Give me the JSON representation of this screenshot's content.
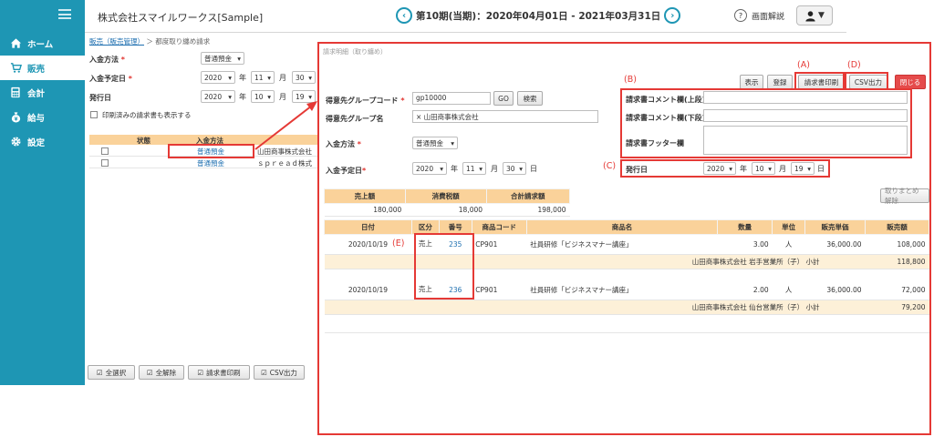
{
  "sidebar": {
    "items": [
      {
        "label": "ホーム",
        "icon": "home-icon"
      },
      {
        "label": "販売",
        "icon": "cart-icon"
      },
      {
        "label": "会計",
        "icon": "calculator-icon"
      },
      {
        "label": "給与",
        "icon": "moneybag-icon"
      },
      {
        "label": "設定",
        "icon": "gear-icon"
      }
    ]
  },
  "header": {
    "company": "株式会社スマイルワークス[Sample]",
    "period": "第10期(当期)：2020年04月01日 - 2021年03月31日",
    "help": "画面解説",
    "help_symbol": "?",
    "prev_symbol": "‹",
    "next_symbol": "›",
    "user_symbol": "▼"
  },
  "base": {
    "breadcrumb_link": "販売（販売管理）",
    "breadcrumb_rest": " ＞ 都度取り纏め請求",
    "label_payment": "入金方法",
    "label_due": "入金予定日",
    "label_issue": "発行日",
    "required_mark": "*",
    "payment_value": "普通預金",
    "due": {
      "year": "2020",
      "month": "11",
      "day": "30"
    },
    "issue": {
      "year": "2020",
      "month": "10",
      "day": "19"
    },
    "u_year": "年",
    "u_month": "月",
    "checkbox_label": "印刷済みの請求書も表示する",
    "table_headers": [
      "状態",
      "入金方法"
    ],
    "rows": [
      {
        "method": "普通預金",
        "customer": "山田商事株式会社"
      },
      {
        "method": "普通預金",
        "customer": "ｓｐｒｅａｄ株式"
      }
    ],
    "buttons": [
      "全選択",
      "全解除",
      "請求書印刷",
      "CSV出力"
    ]
  },
  "modal": {
    "title": "請求明細（取り纏め）",
    "toolbar": [
      "表示",
      "登録",
      "請求書印刷",
      "CSV出力",
      "閉じる"
    ],
    "label_group_code": "得意先グループコード",
    "group_code": "gp10000",
    "btn_go": "GO",
    "btn_search": "検索",
    "label_group_name": "得意先グループ名",
    "group_name": "× 山田商事株式会社",
    "label_payment": "入金方法",
    "payment_value": "普通預金",
    "label_due": "入金予定日",
    "due": {
      "year": "2020",
      "month": "11",
      "day": "30"
    },
    "label_comment_top": "請求書コメント欄(上段)",
    "label_comment_bottom": "請求書コメント欄(下段)",
    "label_footer": "請求書フッター欄",
    "label_issue": "発行日",
    "issue": {
      "year": "2020",
      "month": "10",
      "day": "19"
    },
    "btn_unmerge": "取りまとめ解除",
    "summary": {
      "headers": [
        "売上額",
        "消費税額",
        "合計請求額"
      ],
      "values": [
        "180,000",
        "18,000",
        "198,000"
      ]
    },
    "detail_headers": [
      "日付",
      "区分",
      "番号",
      "商品コード",
      "商品名",
      "数量",
      "単位",
      "販売単価",
      "販売額"
    ],
    "details": [
      {
        "date": "2020/10/19",
        "kubun": "売上",
        "number": "235",
        "code": "CP901",
        "product": "社員研修「ビジネスマナー講座」",
        "qty": "3.00",
        "unit": "人",
        "price": "36,000.00",
        "amount": "108,000",
        "subtotal_label": "山田商事株式会社 岩手営業所（子） 小計",
        "subtotal": "118,800"
      },
      {
        "date": "2020/10/19",
        "kubun": "売上",
        "number": "236",
        "code": "CP901",
        "product": "社員研修「ビジネスマナー講座」",
        "qty": "2.00",
        "unit": "人",
        "price": "36,000.00",
        "amount": "72,000",
        "subtotal_label": "山田商事株式会社 仙台営業所（子） 小計",
        "subtotal": "79,200"
      }
    ]
  },
  "annotations": {
    "a": "(A)",
    "b": "(B)",
    "c": "(C)",
    "d": "(D)",
    "e": "(E)"
  },
  "colors": {
    "sidebar": "#1e96b4",
    "accent_red": "#e53935",
    "table_header": "#fad29a"
  }
}
